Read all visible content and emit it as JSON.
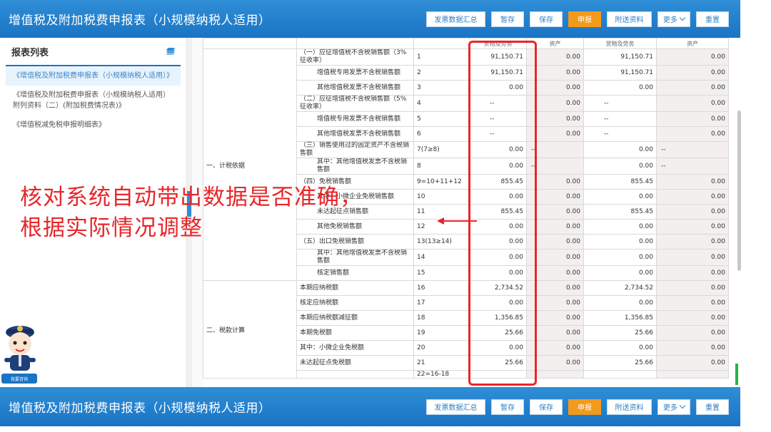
{
  "app_title": "增值税及附加税费申报表（小规模纳税人适用）",
  "toolbar": {
    "invoice_summary": "发票数据汇总",
    "stage_save": "暂存",
    "save": "保存",
    "declare": "申报",
    "attach": "附送资料",
    "more": "更多",
    "reset": "重置"
  },
  "sidebar": {
    "header": "报表列表",
    "items": [
      {
        "label": "《增值税及附加税费申报表（小规模纳税人适用）》"
      },
      {
        "label": "《增值税及附加税费申报表（小规模纳税人适用）附列资料（二）(附加税费情况表)》"
      },
      {
        "label": "《增值税减免税申报明细表》"
      }
    ]
  },
  "table": {
    "header": {
      "col3": "货物及劳务",
      "col4": "资产",
      "col5": "货物及劳务",
      "col6": "资产"
    },
    "group1": "一、计税依据",
    "group2": "二、税款计算",
    "rows": [
      {
        "item": "（一）应征增值税不含税销售额（3%征收率）",
        "line": "1",
        "v1": "91,150.71",
        "v2": "0.00",
        "v3": "91,150.71",
        "v4": "0.00"
      },
      {
        "item": "增值税专用发票不含税销售额",
        "line": "2",
        "v1": "91,150.71",
        "v2": "0.00",
        "v3": "91,150.71",
        "v4": "0.00"
      },
      {
        "item": "其他增值税发票不含税销售额",
        "line": "3",
        "v1": "0.00",
        "v2": "0.00",
        "v3": "0.00",
        "v4": "0.00"
      },
      {
        "item": "（二）应征增值税不含税销售额（5%征收率）",
        "line": "4",
        "v1": "--",
        "v2": "0.00",
        "v3": "--",
        "v4": "0.00"
      },
      {
        "item": "增值税专用发票不含税销售额",
        "line": "5",
        "v1": "--",
        "v2": "0.00",
        "v3": "--",
        "v4": "0.00"
      },
      {
        "item": "其他增值税发票不含税销售额",
        "line": "6",
        "v1": "--",
        "v2": "0.00",
        "v3": "--",
        "v4": "0.00"
      },
      {
        "item": "（三）销售使用过的固定资产不含税销售额",
        "line": "7(7≥8)",
        "v1": "0.00",
        "v2": "--",
        "v3": "0.00",
        "v4": "--"
      },
      {
        "item": "其中：其他增值税发票不含税销售额",
        "line": "8",
        "v1": "0.00",
        "v2": "--",
        "v3": "0.00",
        "v4": "--"
      },
      {
        "item": "（四）免税销售额",
        "line": "9=10+11+12",
        "v1": "855.45",
        "v2": "0.00",
        "v3": "855.45",
        "v4": "0.00"
      },
      {
        "item": "其中：小微企业免税销售额",
        "line": "10",
        "v1": "0.00",
        "v2": "0.00",
        "v3": "0.00",
        "v4": "0.00"
      },
      {
        "item": "未达起征点销售额",
        "line": "11",
        "v1": "855.45",
        "v2": "0.00",
        "v3": "855.45",
        "v4": "0.00"
      },
      {
        "item": "其他免税销售额",
        "line": "12",
        "v1": "0.00",
        "v2": "0.00",
        "v3": "0.00",
        "v4": "0.00"
      },
      {
        "item": "（五）出口免税销售额",
        "line": "13(13≥14)",
        "v1": "0.00",
        "v2": "0.00",
        "v3": "0.00",
        "v4": "0.00"
      },
      {
        "item": "其中：其他增值税发票不含税销售额",
        "line": "14",
        "v1": "0.00",
        "v2": "0.00",
        "v3": "0.00",
        "v4": "0.00"
      },
      {
        "item": "核定销售额",
        "line": "15",
        "v1": "0.00",
        "v2": "0.00",
        "v3": "0.00",
        "v4": "0.00"
      },
      {
        "item": "本期应纳税额",
        "line": "16",
        "v1": "2,734.52",
        "v2": "0.00",
        "v3": "2,734.52",
        "v4": "0.00"
      },
      {
        "item": "核定应纳税额",
        "line": "17",
        "v1": "0.00",
        "v2": "0.00",
        "v3": "0.00",
        "v4": "0.00"
      },
      {
        "item": "本期应纳税额减征额",
        "line": "18",
        "v1": "1,356.85",
        "v2": "0.00",
        "v3": "1,356.85",
        "v4": "0.00"
      },
      {
        "item": "本期免税额",
        "line": "19",
        "v1": "25.66",
        "v2": "0.00",
        "v3": "25.66",
        "v4": "0.00"
      },
      {
        "item": "其中：小微企业免税额",
        "line": "20",
        "v1": "0.00",
        "v2": "0.00",
        "v3": "0.00",
        "v4": "0.00"
      },
      {
        "item": "未达起征点免税额",
        "line": "21",
        "v1": "25.66",
        "v2": "0.00",
        "v3": "25.66",
        "v4": "0.00"
      },
      {
        "item": "",
        "line": "22=16-18",
        "v1": "",
        "v2": "",
        "v3": "",
        "v4": ""
      }
    ]
  },
  "annotation": {
    "line1": "核对系统自动带出数据是否准确，",
    "line2": "根据实际情况调整"
  },
  "mascot_label": "我要咨询",
  "colors": {
    "accent": "#1a74c4",
    "highlight": "#e8262a",
    "declare": "#f29a1b"
  }
}
